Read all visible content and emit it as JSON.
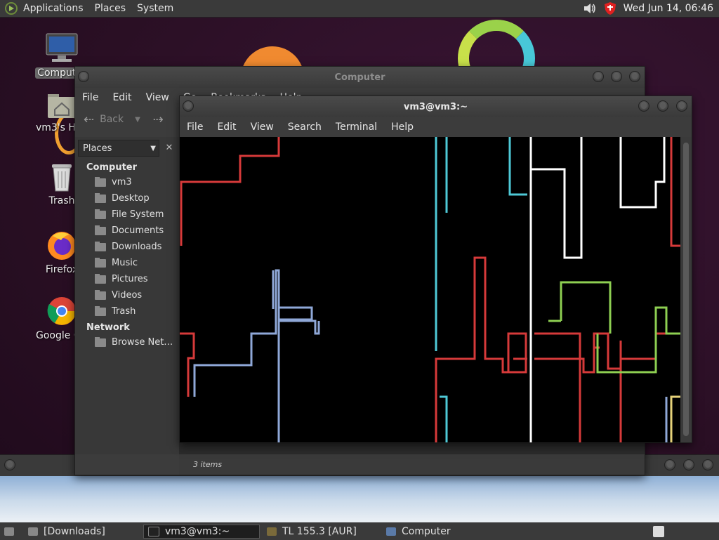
{
  "top_panel": {
    "menus": [
      "Applications",
      "Places",
      "System"
    ],
    "clock": "Wed Jun 14, 06:46"
  },
  "desktop_icons": [
    {
      "label": "Computer",
      "icon": "computer-icon"
    },
    {
      "label": "vm3's Home",
      "icon": "home-folder-icon"
    },
    {
      "label": "Trash",
      "icon": "trash-icon"
    },
    {
      "label": "Firefox",
      "icon": "firefox-icon"
    },
    {
      "label": "Google Chrome",
      "icon": "chrome-icon"
    }
  ],
  "caja": {
    "title": "Computer",
    "menus": [
      "File",
      "Edit",
      "View",
      "Go",
      "Bookmarks",
      "Help"
    ],
    "back_label": "Back",
    "places_label": "Places",
    "sections": [
      {
        "header": "Computer",
        "items": [
          "vm3",
          "Desktop",
          "File System",
          "Documents",
          "Downloads",
          "Music",
          "Pictures",
          "Videos",
          "Trash"
        ]
      },
      {
        "header": "Network",
        "items": [
          "Browse Net…"
        ]
      }
    ],
    "status": "3 items"
  },
  "terminal": {
    "title": "vm3@vm3:~",
    "menus": [
      "File",
      "Edit",
      "View",
      "Search",
      "Terminal",
      "Help"
    ],
    "pipe_colors": [
      "#d63a3a",
      "#4ec9d6",
      "#ffffff",
      "#8ecf52",
      "#8fa8d8",
      "#e6d27a"
    ]
  },
  "taskbar": {
    "tasks": [
      {
        "label": "[Downloads]",
        "icon": "folder-icon",
        "active": false
      },
      {
        "label": "vm3@vm3:~",
        "icon": "terminal-icon",
        "active": true
      },
      {
        "label": "TL 155.3 [AUR]",
        "icon": "package-icon",
        "active": false
      },
      {
        "label": "Computer",
        "icon": "computer-icon",
        "active": false
      }
    ]
  }
}
